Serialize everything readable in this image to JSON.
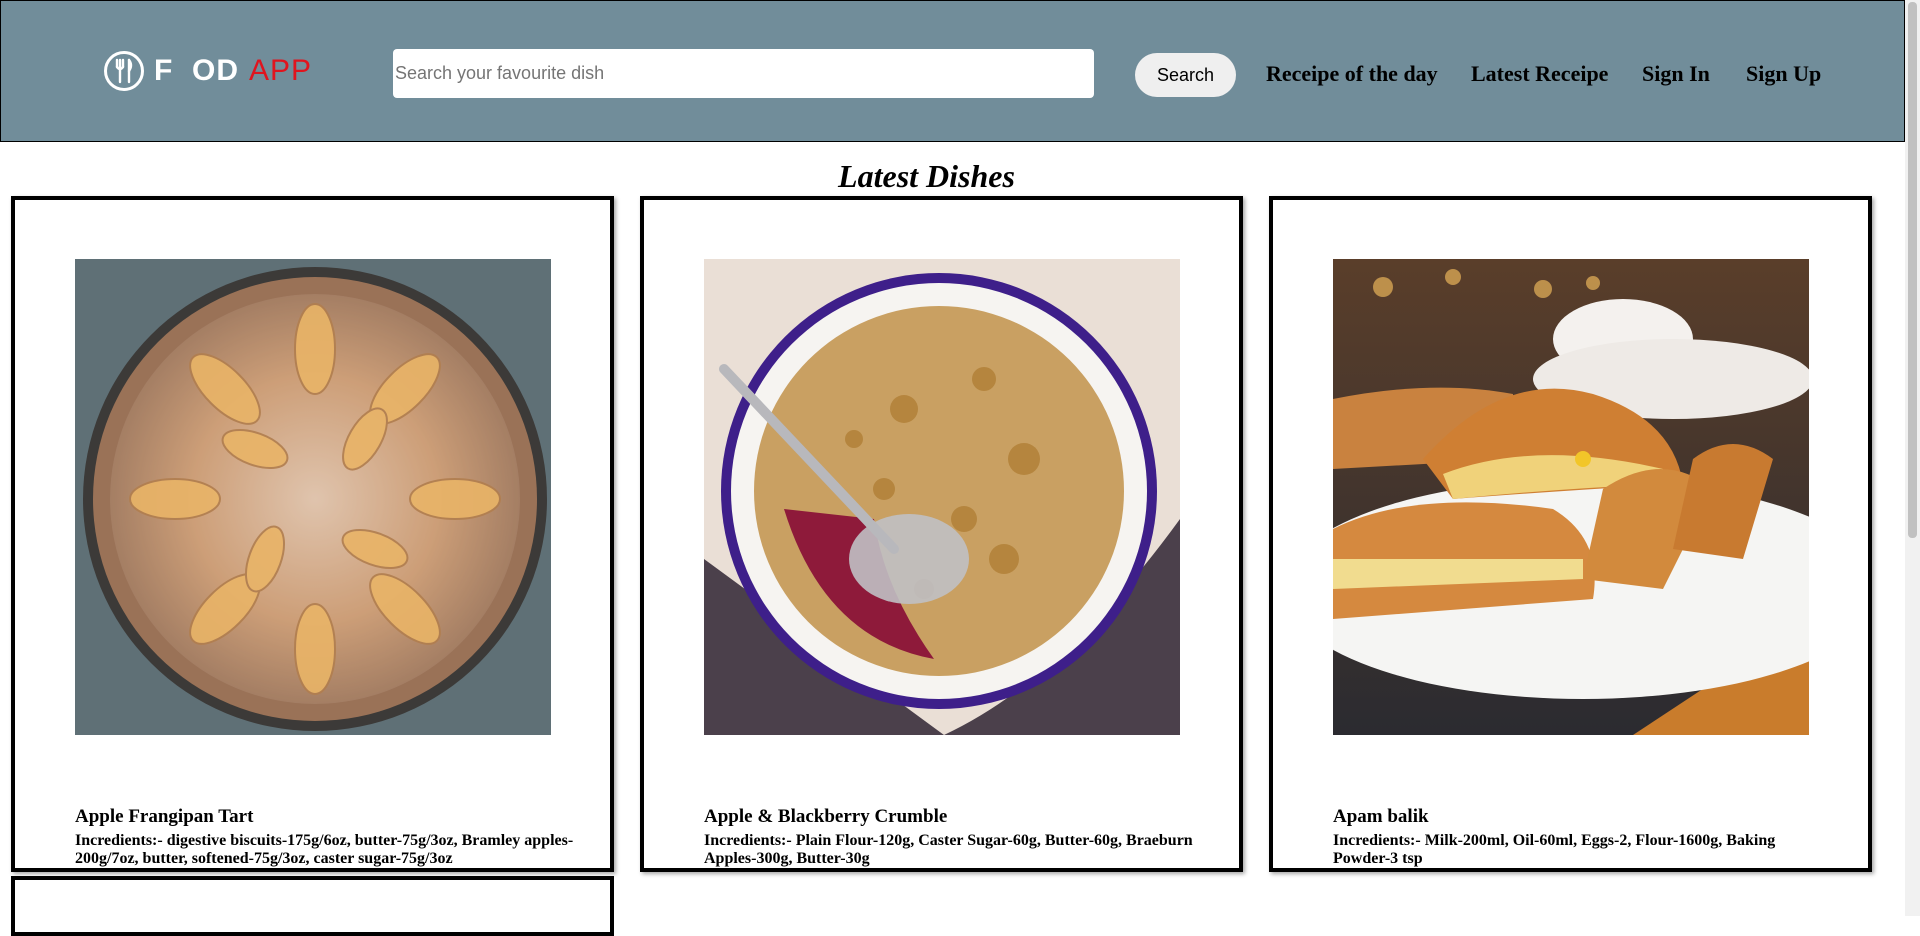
{
  "brand": {
    "food": "F  OD",
    "app": "APP"
  },
  "search": {
    "placeholder": "Search your favourite dish",
    "button_label": "Search"
  },
  "nav": {
    "recipe_of_day": "Receipe of the day",
    "latest_recipe": "Latest Receipe",
    "sign_in": "Sign In",
    "sign_up": "Sign Up"
  },
  "section_title": "Latest Dishes",
  "dishes": [
    {
      "name": "Apple Frangipan Tart",
      "ingredients": "Incredients:- digestive biscuits-175g/6oz, butter-75g/3oz, Bramley apples-200g/7oz, butter, softened-75g/3oz, caster sugar-75g/3oz"
    },
    {
      "name": "Apple & Blackberry Crumble",
      "ingredients": "Incredients:- Plain Flour-120g, Caster Sugar-60g, Butter-60g, Braeburn Apples-300g, Butter-30g"
    },
    {
      "name": "Apam balik",
      "ingredients": "Incredients:- Milk-200ml, Oil-60ml, Eggs-2, Flour-1600g, Baking Powder-3 tsp"
    }
  ],
  "colors": {
    "header_bg": "#718d9a",
    "brand_red": "#e0141e"
  },
  "icons": {
    "logo": "fork-knife-icon"
  }
}
